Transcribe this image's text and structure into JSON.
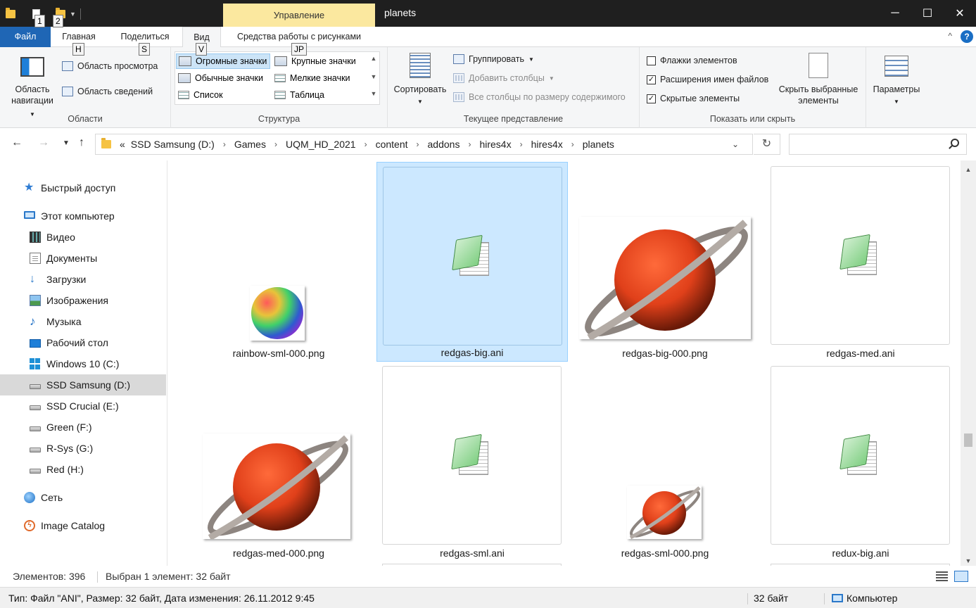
{
  "window": {
    "title": "planets",
    "context_tab": "Управление",
    "keytips": [
      "1",
      "2"
    ],
    "controls": {
      "minimize": "─",
      "maximize": "☐",
      "close": "✕"
    }
  },
  "ribbon_tabs": [
    {
      "label": "Файл"
    },
    {
      "label": "Главная",
      "keytip": "H"
    },
    {
      "label": "Поделиться",
      "keytip": "S"
    },
    {
      "label": "Вид",
      "keytip": "V"
    },
    {
      "label": "Средства работы с рисунками",
      "keytip": "JP"
    }
  ],
  "ribbon": {
    "panes": {
      "label": "Области",
      "nav_pane": "Область навигации",
      "preview_pane": "Область просмотра",
      "details_pane": "Область сведений"
    },
    "layout": {
      "label": "Структура",
      "items": [
        "Огромные значки",
        "Крупные значки",
        "Обычные значки",
        "Мелкие значки",
        "Список",
        "Таблица"
      ],
      "selected": "Огромные значки"
    },
    "current_view": {
      "label": "Текущее представление",
      "sort": "Сортировать",
      "group": "Группировать",
      "add_columns": "Добавить столбцы",
      "fit_columns": "Все столбцы по размеру содержимого"
    },
    "show_hide": {
      "label": "Показать или скрыть",
      "checkboxes": [
        {
          "label": "Флажки элементов",
          "checked": false
        },
        {
          "label": "Расширения имен файлов",
          "checked": true
        },
        {
          "label": "Скрытые элементы",
          "checked": true
        }
      ],
      "hide_selected": "Скрыть выбранные элементы"
    },
    "options": "Параметры"
  },
  "address": {
    "overflow": "«",
    "crumbs": [
      "SSD Samsung (D:)",
      "Games",
      "UQM_HD_2021",
      "content",
      "addons",
      "hires4x",
      "hires4x",
      "planets"
    ],
    "search_placeholder": ""
  },
  "sidebar": {
    "items": [
      {
        "label": "Быстрый доступ",
        "icon": "star-icon"
      },
      {
        "label": "Этот компьютер",
        "icon": "computer-icon"
      },
      {
        "label": "Видео",
        "icon": "video-icon"
      },
      {
        "label": "Документы",
        "icon": "documents-icon"
      },
      {
        "label": "Загрузки",
        "icon": "downloads-icon"
      },
      {
        "label": "Изображения",
        "icon": "pictures-icon"
      },
      {
        "label": "Музыка",
        "icon": "music-icon"
      },
      {
        "label": "Рабочий стол",
        "icon": "desktop-icon"
      },
      {
        "label": "Windows 10 (C:)",
        "icon": "windows-drive-icon"
      },
      {
        "label": "SSD Samsung (D:)",
        "icon": "drive-icon",
        "selected": true
      },
      {
        "label": "SSD Crucial (E:)",
        "icon": "drive-icon"
      },
      {
        "label": "Green (F:)",
        "icon": "drive-icon"
      },
      {
        "label": "R-Sys (G:)",
        "icon": "drive-icon"
      },
      {
        "label": "Red (H:)",
        "icon": "drive-icon"
      },
      {
        "label": "Сеть",
        "icon": "network-icon"
      },
      {
        "label": "Image Catalog",
        "icon": "image-catalog-icon"
      }
    ]
  },
  "files": [
    {
      "name": "rainbow-sml-000.png",
      "kind": "png-planet"
    },
    {
      "name": "redgas-big.ani",
      "kind": "ani",
      "selected": true
    },
    {
      "name": "redgas-big-000.png",
      "kind": "png-ringed"
    },
    {
      "name": "redgas-med.ani",
      "kind": "ani"
    },
    {
      "name": "redgas-med-000.png",
      "kind": "png-ringed"
    },
    {
      "name": "redgas-sml.ani",
      "kind": "ani"
    },
    {
      "name": "redgas-sml-000.png",
      "kind": "png-ringed"
    },
    {
      "name": "redux-big.ani",
      "kind": "ani"
    }
  ],
  "status": {
    "count": "Элементов: 396",
    "selection": "Выбран 1 элемент: 32 байт",
    "details": "Тип: Файл \"ANI\", Размер: 32 байт, Дата изменения: 26.11.2012 9:45",
    "size": "32 байт",
    "location": "Компьютер"
  }
}
